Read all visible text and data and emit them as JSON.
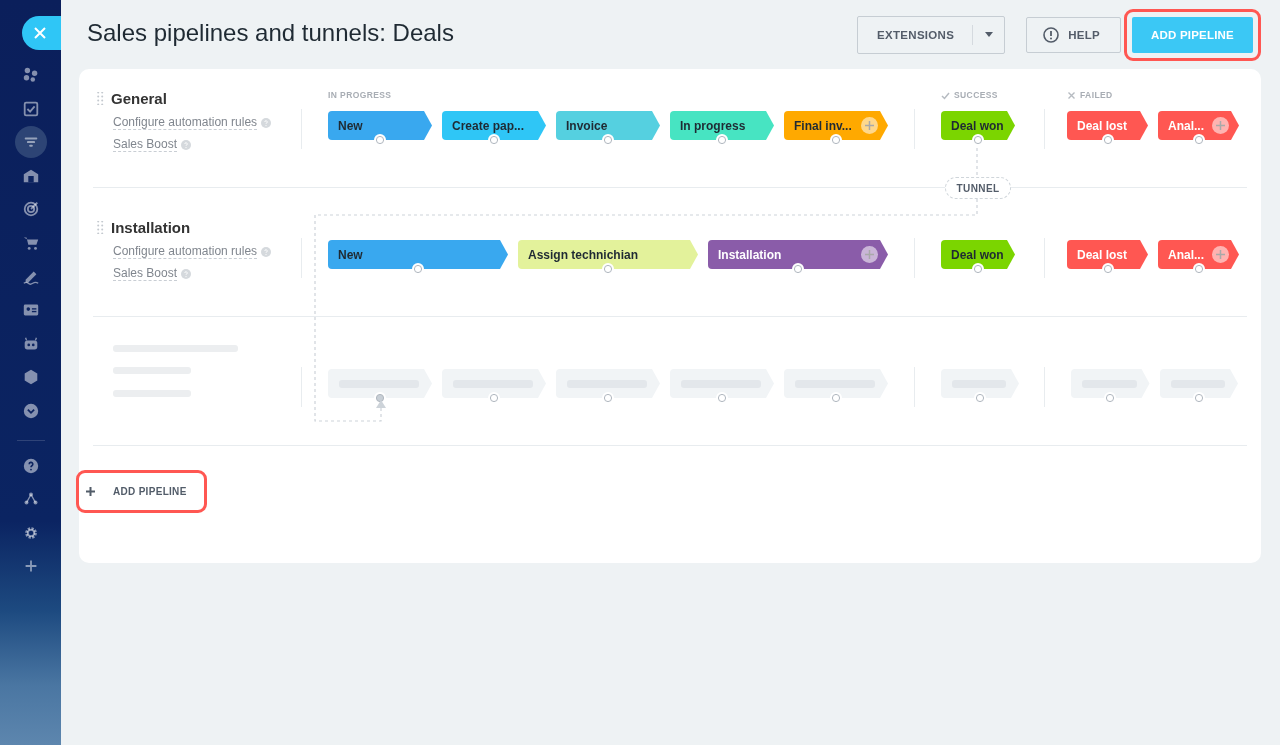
{
  "sidebar": {
    "items": [
      {
        "selected": false
      },
      {
        "selected": false
      },
      {
        "selected": true
      },
      {
        "selected": false
      },
      {
        "selected": false
      },
      {
        "selected": false
      },
      {
        "selected": false
      },
      {
        "selected": false
      },
      {
        "selected": false
      },
      {
        "selected": false
      },
      {
        "selected": false
      }
    ],
    "bottom_items": [
      {
        "selected": false
      },
      {
        "selected": false
      },
      {
        "selected": false
      },
      {
        "selected": false
      }
    ]
  },
  "header": {
    "title": "Sales pipelines and tunnels: Deals",
    "extensions_button": "EXTENSIONS",
    "help_button": "HELP",
    "add_button": {
      "label": "ADD PIPELINE",
      "highlighted": true
    }
  },
  "group_headers": {
    "in_progress": "IN PROGRESS",
    "success": "SUCCESS",
    "failed": "FAILED"
  },
  "pipelines": [
    {
      "title": "General",
      "links": [
        "Configure automation rules",
        "Sales Boost"
      ],
      "in_progress": [
        {
          "name": "New",
          "color": "#39a8ef",
          "light_text": false,
          "add_button": false
        },
        {
          "name": "Create pap...",
          "color": "#2fc6f6",
          "light_text": false,
          "add_button": false
        },
        {
          "name": "Invoice",
          "color": "#55d0e0",
          "light_text": false,
          "add_button": false
        },
        {
          "name": "In progress",
          "color": "#47e4c2",
          "light_text": false,
          "add_button": false
        },
        {
          "name": "Final inv...",
          "color": "#ffa900",
          "light_text": false,
          "add_button": true
        }
      ],
      "success": [
        {
          "name": "Deal won",
          "color": "#7bd500",
          "light_text": false,
          "add_button": false
        }
      ],
      "failed": [
        {
          "name": "Deal lost",
          "color": "#ff5752",
          "light_text": true,
          "add_button": false
        },
        {
          "name": "Anal...",
          "color": "#ff5752",
          "light_text": true,
          "add_button": true
        }
      ]
    },
    {
      "title": "Installation",
      "links": [
        "Configure automation rules",
        "Sales Boost"
      ],
      "in_progress": [
        {
          "name": "New",
          "color": "#39a8ef",
          "light_text": false,
          "add_button": false
        },
        {
          "name": "Assign technichian",
          "color": "#e3f29b",
          "light_text": false,
          "add_button": false
        },
        {
          "name": "Installation",
          "color": "#8a5ca9",
          "light_text": true,
          "add_button": true
        }
      ],
      "success": [
        {
          "name": "Deal won",
          "color": "#7bd500",
          "light_text": false,
          "add_button": false
        }
      ],
      "failed": [
        {
          "name": "Deal lost",
          "color": "#ff5752",
          "light_text": true,
          "add_button": false
        },
        {
          "name": "Anal...",
          "color": "#ff5752",
          "light_text": true,
          "add_button": true
        }
      ]
    }
  ],
  "tunnel": {
    "label": "TUNNEL"
  },
  "bottom_add_button": {
    "label": "ADD PIPELINE",
    "highlighted": true
  }
}
